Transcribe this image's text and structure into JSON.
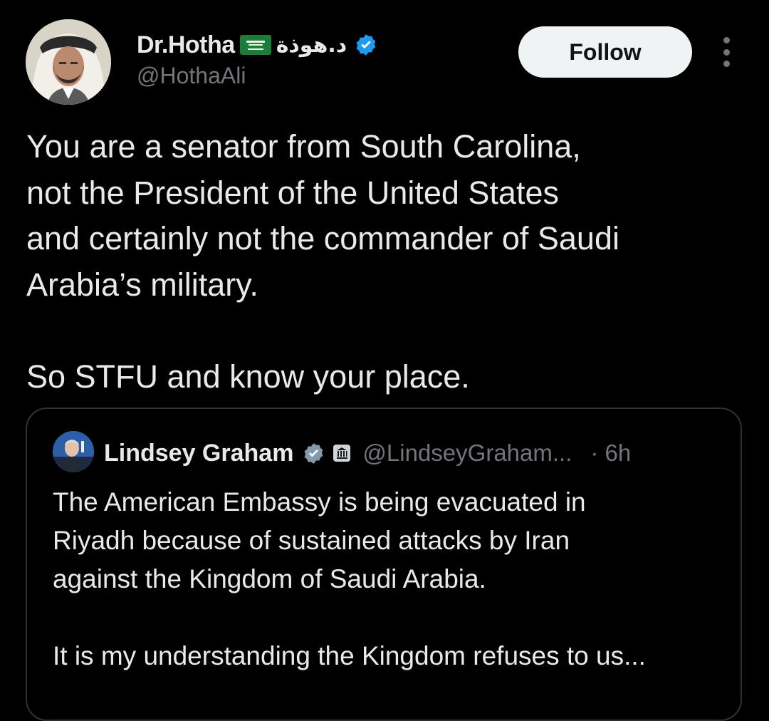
{
  "author": {
    "display_name": "Dr.Hotha",
    "arabic_name": "د.هوذة",
    "handle": "@HothaAli",
    "icons": [
      "avatar",
      "saudi-flag-icon",
      "verified-icon"
    ]
  },
  "actions": {
    "follow_label": "Follow",
    "more_icon": "more-vertical-icon"
  },
  "tweet": {
    "lines": [
      "You are a senator from South Carolina,",
      "not the President of the United States",
      "and certainly not the commander of Saudi",
      "Arabia’s military."
    ],
    "closing": "So STFU and know your place."
  },
  "quoted": {
    "name": "Lindsey Graham",
    "handle": "@LindseyGraham...",
    "time": "· 6h",
    "icons": [
      "verified-icon",
      "government-badge-icon"
    ],
    "lines": [
      "The American Embassy is being evacuated in",
      "Riyadh because of sustained attacks by Iran",
      "against the Kingdom of Saudi Arabia."
    ],
    "closing": "It is my understanding the Kingdom refuses to us..."
  },
  "colors": {
    "background": "#000000",
    "text": "#e7e9ea",
    "secondary_text": "#71767b",
    "verified": "#1d9bf0",
    "quoted_verified": "#829aab",
    "follow_bg": "#eff3f4",
    "border": "#2f3336"
  }
}
